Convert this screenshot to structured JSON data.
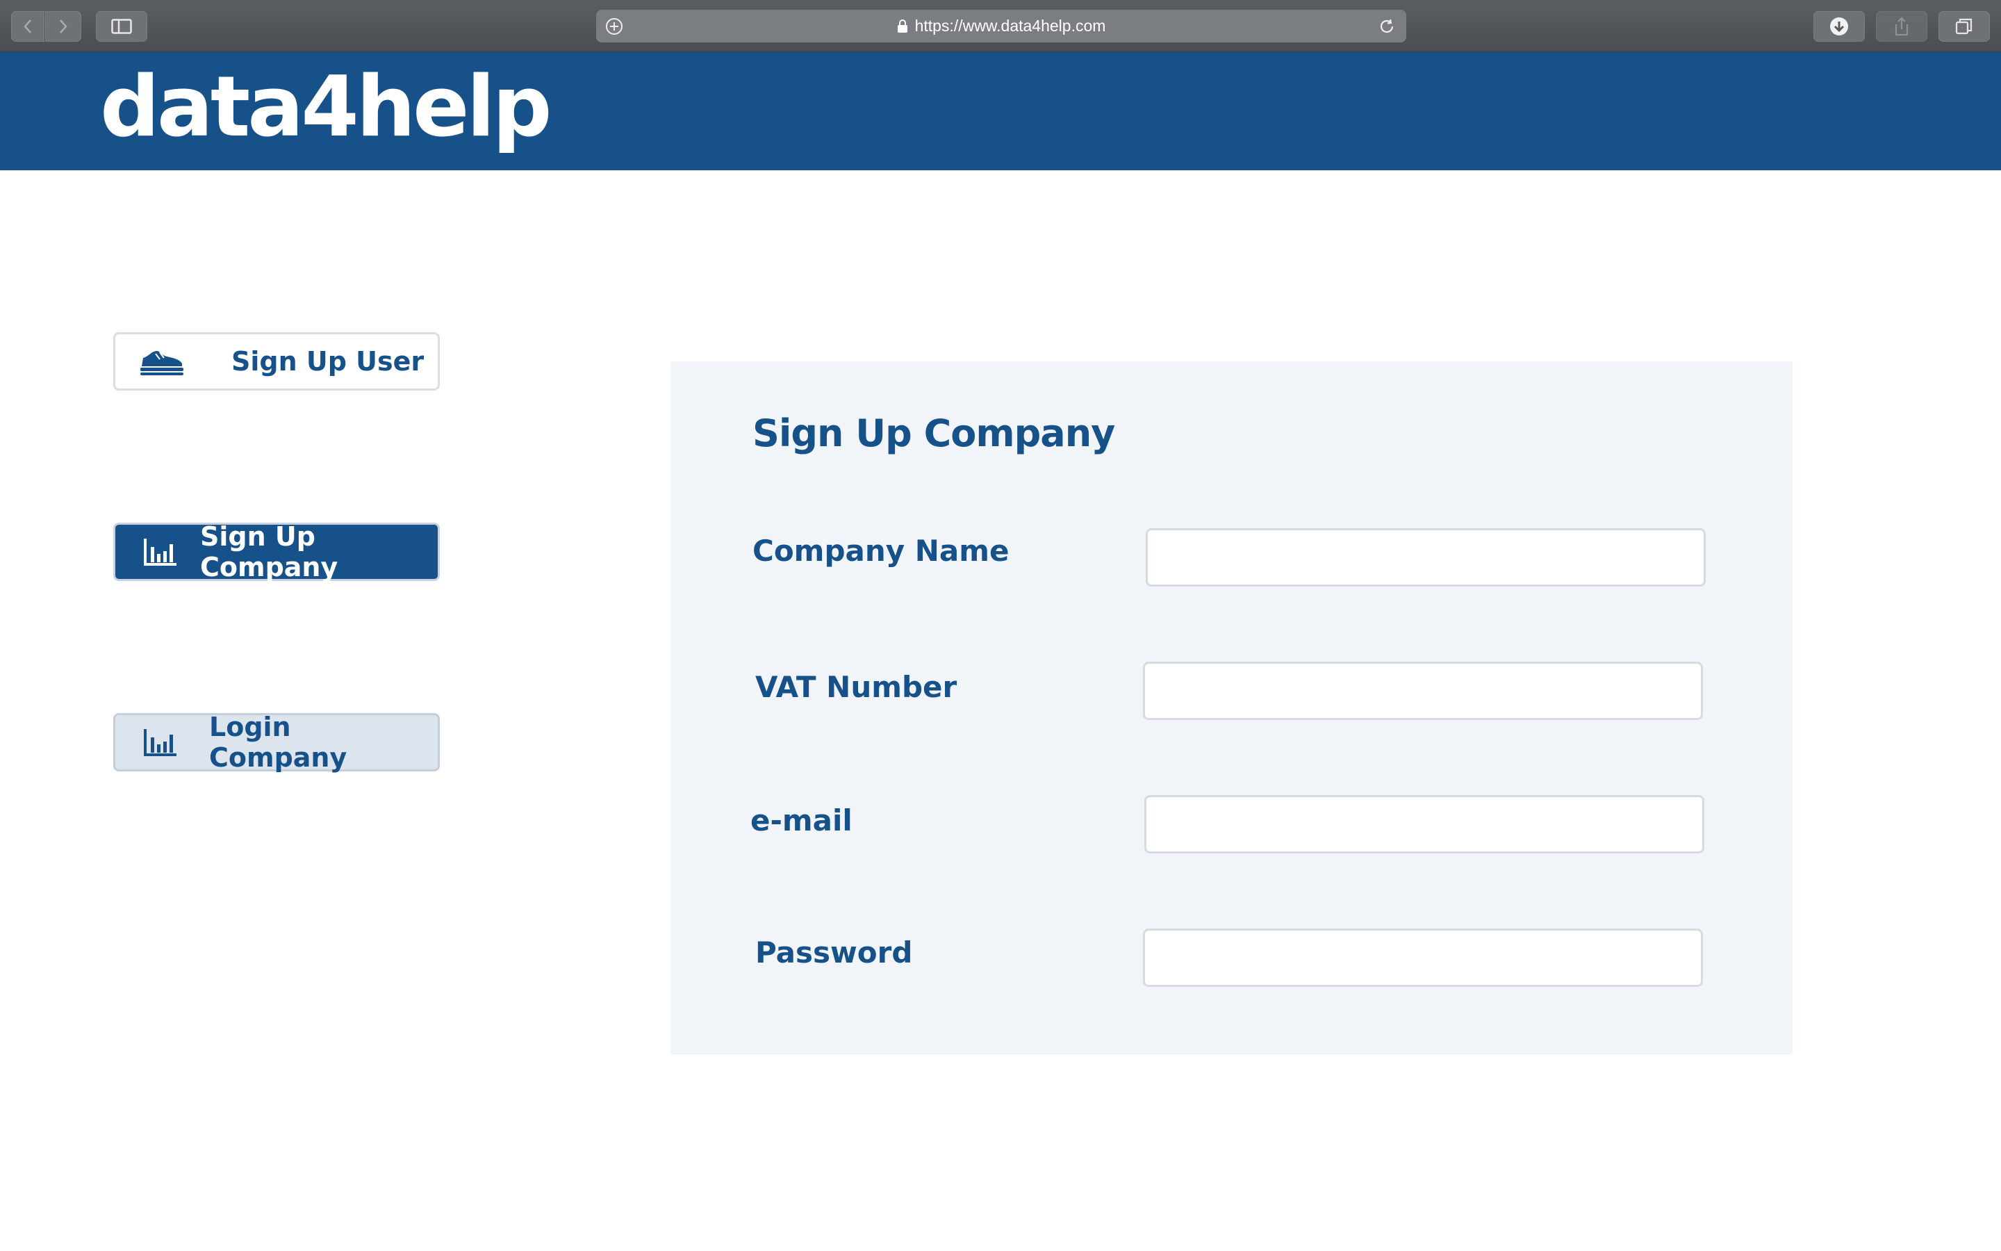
{
  "browser": {
    "url": "https://www.data4help.com"
  },
  "header": {
    "brand": "data4help",
    "brand_color": "#17518a"
  },
  "sidebar": {
    "items": [
      {
        "label": "Sign Up User",
        "icon": "sneaker-icon",
        "state": "default"
      },
      {
        "label": "Sign Up Company",
        "icon": "bar-chart-icon",
        "state": "active"
      },
      {
        "label": "Login Company",
        "icon": "bar-chart-icon",
        "state": "secondary"
      }
    ]
  },
  "form": {
    "title": "Sign Up Company",
    "fields": [
      {
        "label": "Company Name",
        "value": "",
        "type": "text"
      },
      {
        "label": "VAT Number",
        "value": "",
        "type": "text"
      },
      {
        "label": "e-mail",
        "value": "",
        "type": "email"
      },
      {
        "label": "Password",
        "value": "",
        "type": "password"
      }
    ]
  }
}
